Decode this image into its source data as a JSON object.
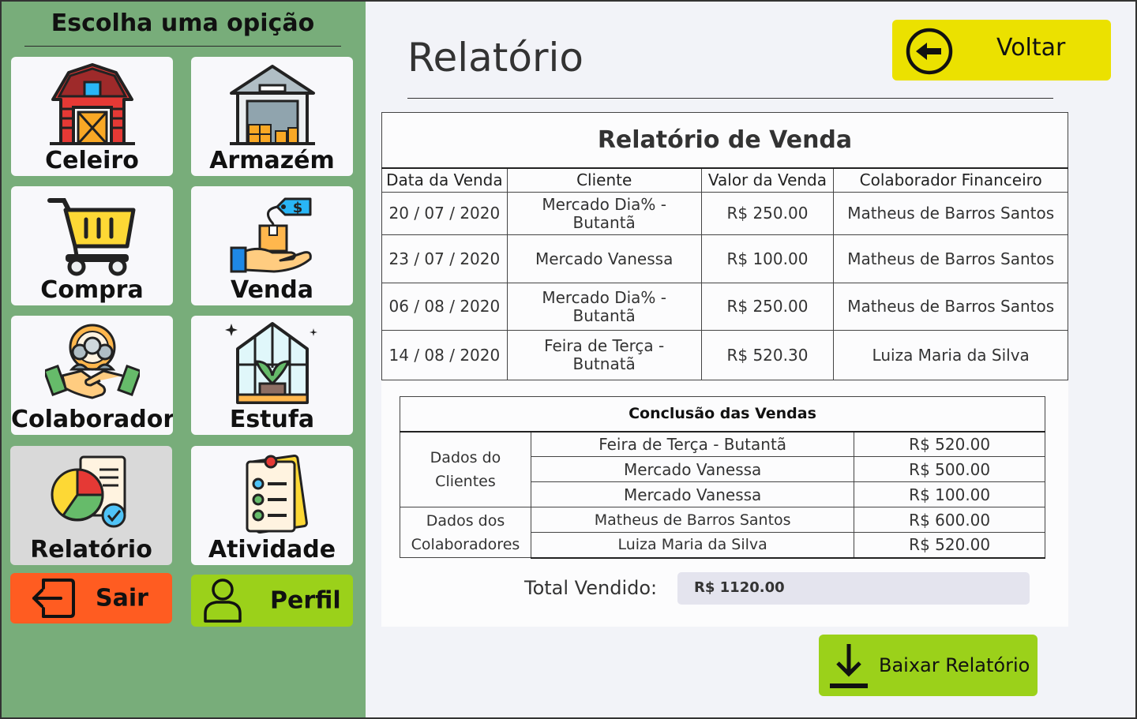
{
  "sidebar": {
    "title": "Escolha uma opição",
    "items": [
      {
        "label": "Celeiro",
        "icon": "barn-icon"
      },
      {
        "label": "Armazém",
        "icon": "warehouse-icon"
      },
      {
        "label": "Compra",
        "icon": "shopping-cart-icon"
      },
      {
        "label": "Venda",
        "icon": "sale-hand-box-icon"
      },
      {
        "label": "Colaborador",
        "icon": "handshake-team-icon"
      },
      {
        "label": "Estufa",
        "icon": "greenhouse-icon"
      },
      {
        "label": "Relatório",
        "icon": "report-pie-chart-icon",
        "active": true
      },
      {
        "label": "Atividade",
        "icon": "checklist-icon"
      }
    ],
    "sair_label": "Sair",
    "perfil_label": "Perfil"
  },
  "header": {
    "title": "Relatório",
    "back_label": "Voltar"
  },
  "sales": {
    "caption": "Relatório de Venda",
    "columns": [
      "Data da Venda",
      "Cliente",
      "Valor da Venda",
      "Colaborador Financeiro"
    ],
    "rows": [
      {
        "date": "20 / 07 / 2020",
        "client": "Mercado Dia% - Butantã",
        "value": "R$ 250.00",
        "collaborator": "Matheus de Barros Santos"
      },
      {
        "date": "23 / 07 / 2020",
        "client": "Mercado Vanessa",
        "value": "R$ 100.00",
        "collaborator": "Matheus de Barros Santos"
      },
      {
        "date": "06 / 08 / 2020",
        "client": "Mercado Dia% - Butantã",
        "value": "R$ 250.00",
        "collaborator": "Matheus de Barros Santos"
      },
      {
        "date": "14 / 08 / 2020",
        "client": "Feira de Terça - Butnatã",
        "value": "R$ 520.30",
        "collaborator": "Luiza Maria da Silva"
      }
    ]
  },
  "summary": {
    "caption": "Conclusão das Vendas",
    "clients_group": "Dados do Clientes",
    "clients": [
      {
        "name": "Feira de Terça - Butantã",
        "value": "R$ 520.00"
      },
      {
        "name": "Mercado Vanessa",
        "value": "R$ 500.00"
      },
      {
        "name": "Mercado Vanessa",
        "value": "R$ 100.00"
      }
    ],
    "collaborators_group": "Dados dos Colaboradores",
    "collaborators": [
      {
        "name": "Matheus de Barros Santos",
        "value": "R$ 600.00"
      },
      {
        "name": "Luiza Maria da Silva",
        "value": "R$ 520.00"
      }
    ],
    "total_label": "Total Vendido:",
    "total_value": "R$ 1120.00"
  },
  "download_label": "Baixar Relatório",
  "colors": {
    "sidebar_bg": "#78ad7a",
    "back_button": "#ebe100",
    "exit_button": "#ff5c21",
    "green_button": "#9bd11a",
    "page_bg": "#f2f3f8"
  }
}
